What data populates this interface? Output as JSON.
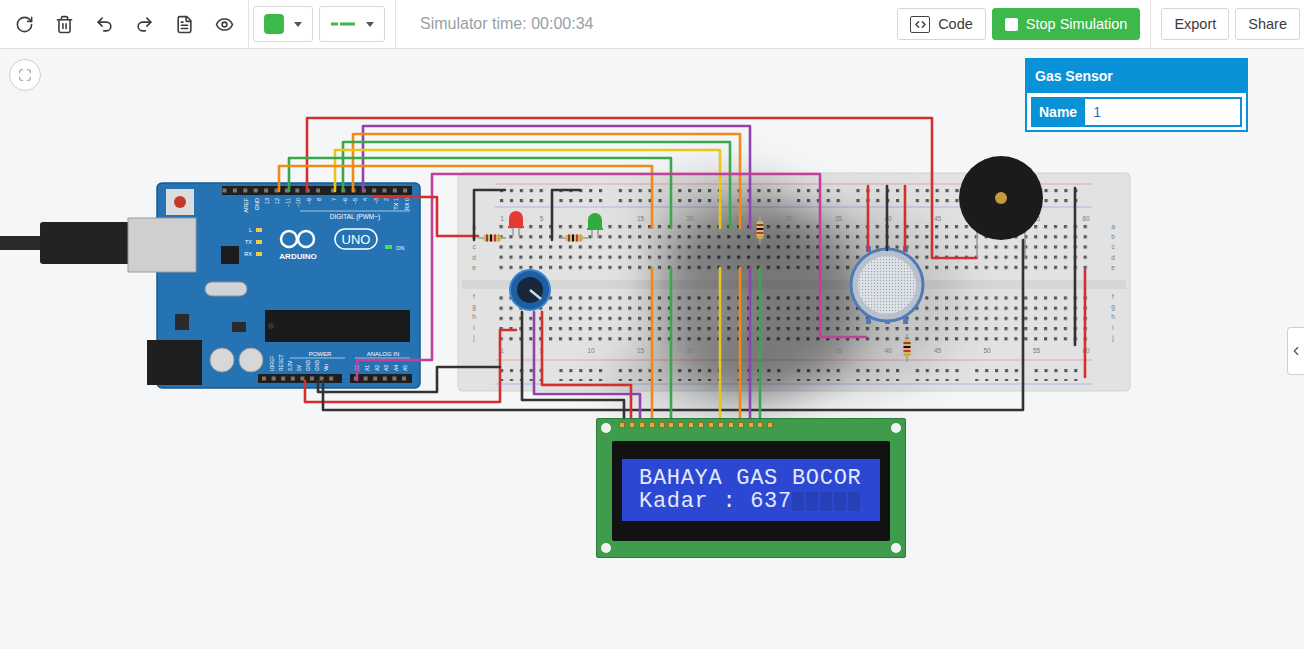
{
  "toolbar": {
    "simulator_time": "Simulator time: 00:00:34",
    "color_swatch": "#3cb94a",
    "line_color": "#3cb94a",
    "buttons": [
      {
        "label": "Code",
        "kind": "code"
      },
      {
        "label": "Stop Simulation",
        "kind": "stop"
      },
      {
        "label": "Export",
        "kind": "plain"
      },
      {
        "label": "Share",
        "kind": "plain"
      }
    ]
  },
  "inspector": {
    "title": "Gas Sensor",
    "fields": [
      {
        "label": "Name",
        "value": "1"
      }
    ]
  },
  "lcd": {
    "lines": [
      "BAHAYA GAS BOCOR",
      "Kadar : 637"
    ]
  },
  "arduino": {
    "brand": "ARDUINO",
    "model": "UNO",
    "digital_label": "DIGITAL (PWM~)",
    "digital_pins": [
      "AREF",
      "GND",
      "13",
      "12",
      "~11",
      "~10",
      "~9",
      "8",
      "7",
      "~6",
      "~5",
      "4",
      "~3",
      "2",
      "TX 1",
      "RX 0"
    ],
    "led_labels": [
      "L",
      "TX",
      "RX"
    ],
    "power_led_label": "ON",
    "power_label": "POWER",
    "power_pins": [
      "IOREF",
      "RESET",
      "3.3V",
      "5V",
      "GND",
      "GND",
      "Vin"
    ],
    "analog_label": "ANALOG IN",
    "analog_pins": [
      "A0",
      "A1",
      "A2",
      "A3",
      "A4",
      "A5"
    ]
  },
  "breadboard": {
    "columns": [
      "1",
      "5",
      "10",
      "15",
      "20",
      "25",
      "30",
      "35",
      "40",
      "45",
      "50",
      "55",
      "60"
    ],
    "rows_top": [
      "a",
      "b",
      "c",
      "d",
      "e"
    ],
    "rows_bottom": [
      "f",
      "g",
      "h",
      "i",
      "j"
    ]
  },
  "leds": [
    {
      "color": "#e53935"
    },
    {
      "color": "#2fae3d"
    }
  ],
  "wires": [
    {
      "color": "#d32f2f"
    },
    {
      "color": "#8e44ad"
    },
    {
      "color": "#ef8a17"
    },
    {
      "color": "#3aa84a"
    },
    {
      "color": "#e6c619"
    },
    {
      "color": "#3aa84a"
    },
    {
      "color": "#ef8a17"
    },
    {
      "color": "#c2409a"
    },
    {
      "color": "#d32f2f"
    },
    {
      "color": "#333333"
    },
    {
      "color": "#333333"
    },
    {
      "color": "#d32f2f"
    },
    {
      "color": "#333333"
    },
    {
      "color": "#333333"
    },
    {
      "color": "#333333"
    },
    {
      "color": "#d32f2f"
    },
    {
      "color": "#333333"
    },
    {
      "color": "#d32f2f"
    },
    {
      "color": "#8e44ad"
    },
    {
      "color": "#ef8a17"
    },
    {
      "color": "#3aa84a"
    },
    {
      "color": "#e6c619"
    },
    {
      "color": "#ef8a17"
    },
    {
      "color": "#8e44ad"
    },
    {
      "color": "#3aa84a"
    },
    {
      "color": "#d32f2f"
    },
    {
      "color": "#333333"
    },
    {
      "color": "#d32f2f"
    }
  ]
}
